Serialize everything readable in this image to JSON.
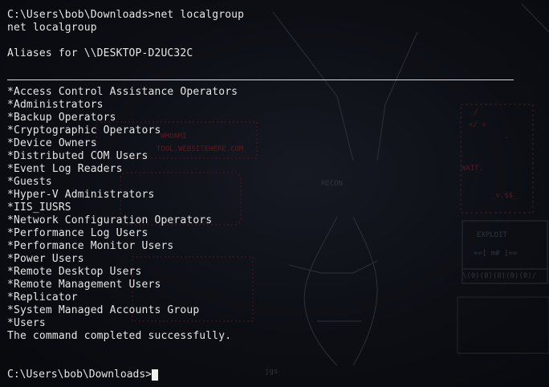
{
  "terminal": {
    "prompt_cmd": "C:\\Users\\bob\\Downloads>net localgroup",
    "echo": "net localgroup",
    "aliases_header": "Aliases for \\\\DESKTOP-D2UC32C",
    "groups": [
      "*Access Control Assistance Operators",
      "*Administrators",
      "*Backup Operators",
      "*Cryptographic Operators",
      "*Device Owners",
      "*Distributed COM Users",
      "*Event Log Readers",
      "*Guests",
      "*Hyper-V Administrators",
      "*IIS_IUSRS",
      "*Network Configuration Operators",
      "*Performance Log Users",
      "*Performance Monitor Users",
      "*Power Users",
      "*Remote Desktop Users",
      "*Remote Management Users",
      "*Replicator",
      "*System Managed Accounts Group",
      "*Users"
    ],
    "completion": "The command completed successfully.",
    "current_prompt": "C:\\Users\\bob\\Downloads>"
  },
  "backdrop": {
    "labels": [
      "RECON",
      "EXPLOIT"
    ]
  },
  "colors": {
    "background": "#0c0e14",
    "text": "#e6e6e6",
    "backdrop_red": "#5a1a1e",
    "backdrop_grey": "#2a2d36"
  }
}
